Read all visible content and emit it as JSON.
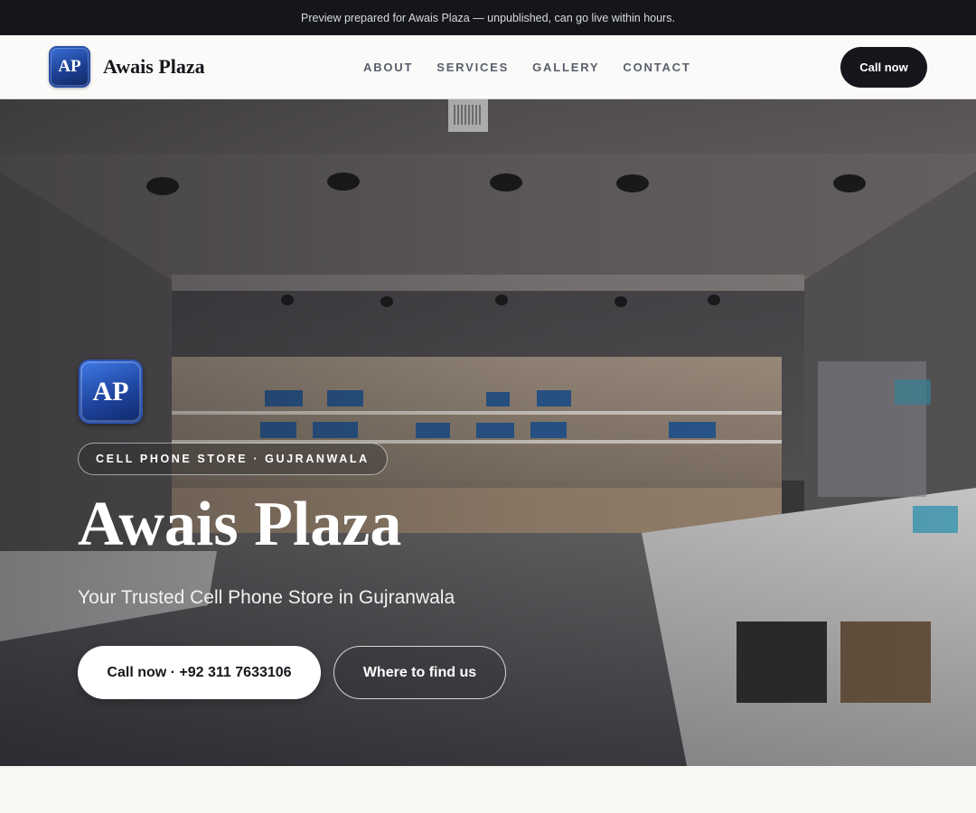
{
  "preview_bar": {
    "text": "Preview prepared for Awais Plaza — unpublished, can go live within hours."
  },
  "header": {
    "logo_text": "AP",
    "brand_name": "Awais Plaza",
    "nav": [
      "ABOUT",
      "SERVICES",
      "GALLERY",
      "CONTACT"
    ],
    "cta_label": "Call now"
  },
  "hero": {
    "logo_text": "AP",
    "tagline_pill": "CELL PHONE STORE · GUJRANWALA",
    "title": "Awais Plaza",
    "subtitle": "Your Trusted Cell Phone Store in Gujranwala",
    "primary_button": "Call now · +92 311 7633106",
    "secondary_button": "Where to find us"
  },
  "colors": {
    "topbar": "#14161b",
    "logo_blue": "#1d3f92",
    "dark_button": "#15171c",
    "page_bg": "#f8f7f4"
  }
}
